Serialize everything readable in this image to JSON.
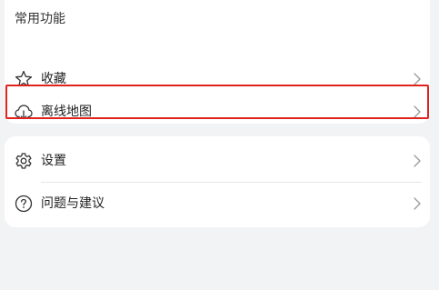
{
  "common_functions": {
    "title": "常用功能",
    "items": [
      {
        "label": "收藏",
        "icon": "star-icon"
      },
      {
        "label": "离线地图",
        "icon": "cloud-download-icon",
        "highlighted": true
      }
    ]
  },
  "settings_group": {
    "items": [
      {
        "label": "设置",
        "icon": "gear-icon"
      },
      {
        "label": "问题与建议",
        "icon": "question-circle-icon"
      }
    ]
  },
  "colors": {
    "background": "#f2f3f5",
    "card": "#ffffff",
    "highlight_border": "#e0231e"
  }
}
